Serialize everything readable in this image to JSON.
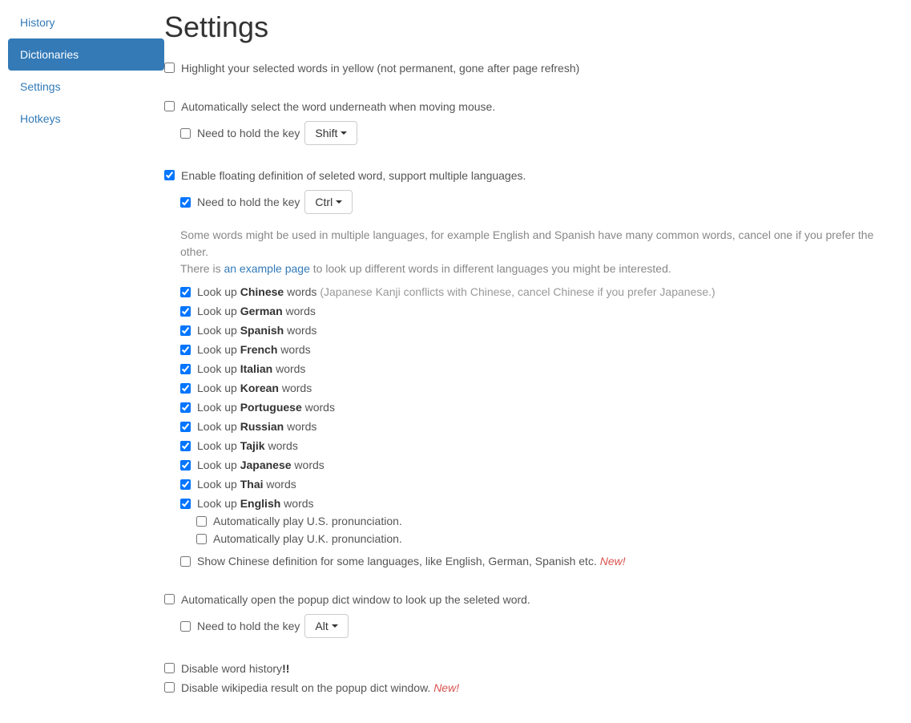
{
  "sidebar": {
    "items": [
      {
        "label": "History",
        "active": false
      },
      {
        "label": "Dictionaries",
        "active": true
      },
      {
        "label": "Settings",
        "active": false
      },
      {
        "label": "Hotkeys",
        "active": false
      }
    ]
  },
  "title": "Settings",
  "highlight": {
    "checked": false,
    "label": "Highlight your selected words in yellow (not permanent, gone after page refresh)"
  },
  "autoSelect": {
    "checked": false,
    "label": "Automatically select the word underneath when moving mouse.",
    "holdKey": {
      "checked": false,
      "label": "Need to hold the key",
      "value": "Shift"
    }
  },
  "floating": {
    "checked": true,
    "label": "Enable floating definition of seleted word, support multiple languages.",
    "holdKey": {
      "checked": true,
      "label": "Need to hold the key",
      "value": "Ctrl"
    },
    "help1": "Some words might be used in multiple languages, for example English and Spanish have many common words, cancel one if you prefer the other.",
    "help2a": "There is ",
    "help2link": "an example page",
    "help2b": " to look up different words in different languages you might be interested.",
    "languages": [
      {
        "checked": true,
        "pre": "Look up ",
        "lang": "Chinese",
        "post": " words ",
        "hint": "(Japanese Kanji conflicts with Chinese, cancel Chinese if you prefer Japanese.)"
      },
      {
        "checked": true,
        "pre": "Look up ",
        "lang": "German",
        "post": " words"
      },
      {
        "checked": true,
        "pre": "Look up ",
        "lang": "Spanish",
        "post": " words"
      },
      {
        "checked": true,
        "pre": "Look up ",
        "lang": "French",
        "post": " words"
      },
      {
        "checked": true,
        "pre": "Look up ",
        "lang": "Italian",
        "post": " words"
      },
      {
        "checked": true,
        "pre": "Look up ",
        "lang": "Korean",
        "post": " words"
      },
      {
        "checked": true,
        "pre": "Look up ",
        "lang": "Portuguese",
        "post": " words"
      },
      {
        "checked": true,
        "pre": "Look up ",
        "lang": "Russian",
        "post": " words"
      },
      {
        "checked": true,
        "pre": "Look up ",
        "lang": "Tajik",
        "post": " words"
      },
      {
        "checked": true,
        "pre": "Look up ",
        "lang": "Japanese",
        "post": " words"
      },
      {
        "checked": true,
        "pre": "Look up ",
        "lang": "Thai",
        "post": " words"
      },
      {
        "checked": true,
        "pre": "Look up ",
        "lang": "English",
        "post": " words"
      }
    ],
    "english_sub": [
      {
        "checked": false,
        "label": "Automatically play U.S. pronunciation."
      },
      {
        "checked": false,
        "label": "Automatically play U.K. pronunciation."
      }
    ],
    "chineseDef": {
      "checked": false,
      "label": "Show Chinese definition for some languages, like English, German, Spanish etc. ",
      "newTag": "New!"
    }
  },
  "autoPopup": {
    "checked": false,
    "label": "Automatically open the popup dict window to look up the seleted word.",
    "holdKey": {
      "checked": false,
      "label": "Need to hold the key",
      "value": "Alt"
    }
  },
  "disableHistory": {
    "checked": false,
    "label": "Disable word history",
    "suffix": "!!"
  },
  "disableWikipedia": {
    "checked": false,
    "label": "Disable wikipedia result on the popup dict window. ",
    "newTag": "New!"
  }
}
